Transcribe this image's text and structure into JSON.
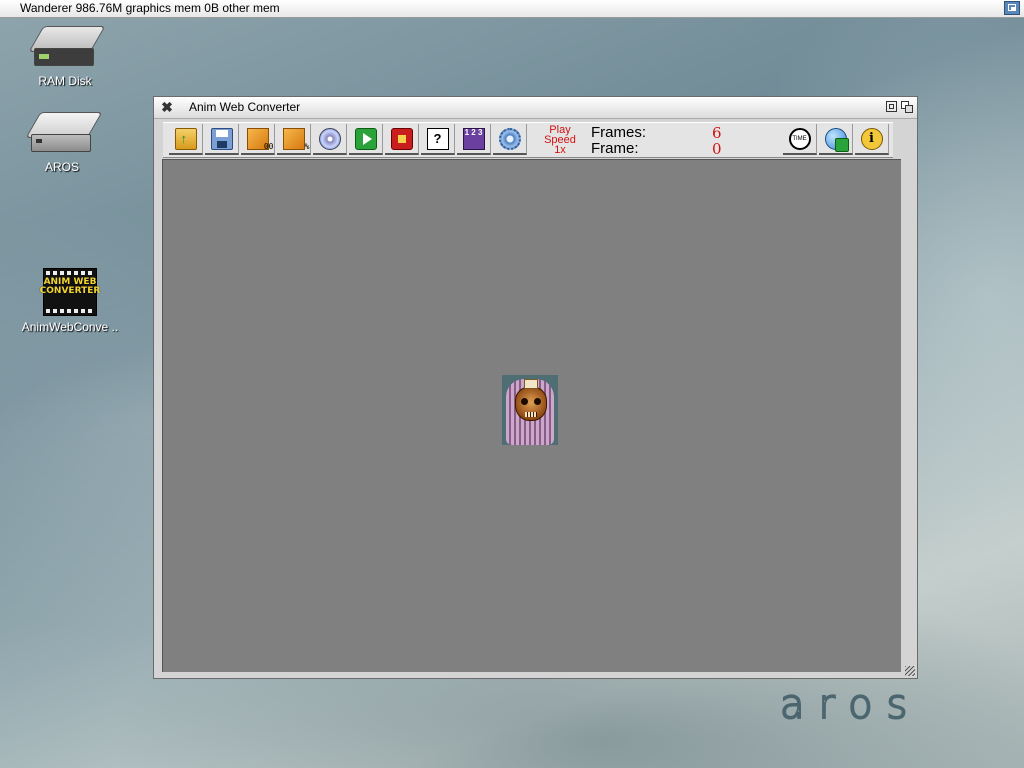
{
  "menubar": {
    "title": "Wanderer 986.76M graphics mem 0B other mem"
  },
  "desktop": {
    "icons": [
      {
        "label": "RAM Disk",
        "icon": "ram-disk-icon"
      },
      {
        "label": "AROS",
        "icon": "hard-drive-icon"
      },
      {
        "label": "AnimWebConve ..",
        "icon": "anim-web-converter-icon",
        "logo_text": "ANIM WEB CONVERTER"
      }
    ],
    "brand_logo": "aros"
  },
  "window": {
    "title": "Anim Web Converter",
    "toolbar": {
      "buttons": [
        {
          "name": "load",
          "icon": "open-folder-icon"
        },
        {
          "name": "save",
          "icon": "floppy-disk-icon"
        },
        {
          "name": "frame-number",
          "icon": "image-numbered-icon",
          "suffix": "00"
        },
        {
          "name": "frame-percent",
          "icon": "image-percent-icon",
          "suffix": "%"
        },
        {
          "name": "disc",
          "icon": "cd-icon"
        },
        {
          "name": "play",
          "icon": "play-icon"
        },
        {
          "name": "stop",
          "icon": "stop-icon"
        },
        {
          "name": "help",
          "icon": "help-icon",
          "glyph": "?"
        },
        {
          "name": "frames",
          "icon": "frame-sequence-icon",
          "glyph": "1 2 3"
        },
        {
          "name": "settings",
          "icon": "gear-icon"
        },
        {
          "name": "timing",
          "icon": "clock-icon",
          "glyph": "TIME"
        },
        {
          "name": "web-play",
          "icon": "globe-play-icon"
        },
        {
          "name": "info",
          "icon": "info-icon",
          "glyph": "i"
        }
      ],
      "play_speed": {
        "line1": "Play",
        "line2": "Speed",
        "value": "1x"
      },
      "frames_label": "Frames:",
      "frames_value": "6",
      "frame_label": "Frame:",
      "frame_value": "0"
    },
    "canvas": {
      "background": "#808080",
      "preview": "pharaoh-skull-sprite"
    }
  },
  "colors": {
    "accent_red": "#d01212",
    "toolbar_bg": "#e4e4e4",
    "canvas_gray": "#808080"
  }
}
